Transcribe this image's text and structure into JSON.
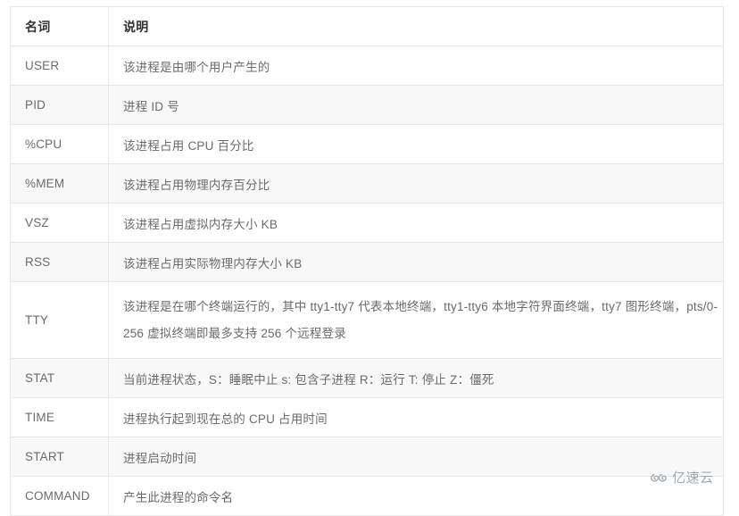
{
  "table": {
    "headers": [
      "名词",
      "说明"
    ],
    "rows": [
      {
        "term": "USER",
        "desc": "该进程是由哪个用户产生的"
      },
      {
        "term": "PID",
        "desc": "进程 ID 号"
      },
      {
        "term": "%CPU",
        "desc": "该进程占用 CPU 百分比"
      },
      {
        "term": "%MEM",
        "desc": "该进程占用物理内存百分比"
      },
      {
        "term": "VSZ",
        "desc": "该进程占用虚拟内存大小 KB"
      },
      {
        "term": "RSS",
        "desc": "该进程占用实际物理内存大小 KB"
      },
      {
        "term": "TTY",
        "desc": "该进程是在哪个终端运行的，其中 tty1-tty7 代表本地终端，tty1-tty6 本地字符界面终端，tty7 图形终端，pts/0-256 虚拟终端即最多支持 256 个远程登录"
      },
      {
        "term": "STAT",
        "desc": "当前进程状态，S：睡眠中止 s: 包含子进程 R：运行 T: 停止 Z：僵死"
      },
      {
        "term": "TIME",
        "desc": "进程执行起到现在总的 CPU 占用时间"
      },
      {
        "term": "START",
        "desc": "进程启动时间"
      },
      {
        "term": "COMMAND",
        "desc": "产生此进程的命令名"
      }
    ]
  },
  "watermark": {
    "text": "亿速云",
    "icon": "cloud-logo-icon",
    "color": "#9aa3ad"
  },
  "colors": {
    "border": "#e8e8e8",
    "header_text": "#333333",
    "body_text": "#6b6b6b",
    "stripe_background": "#f8f8f8",
    "row_background": "#ffffff",
    "page_background": "#ffffff"
  }
}
